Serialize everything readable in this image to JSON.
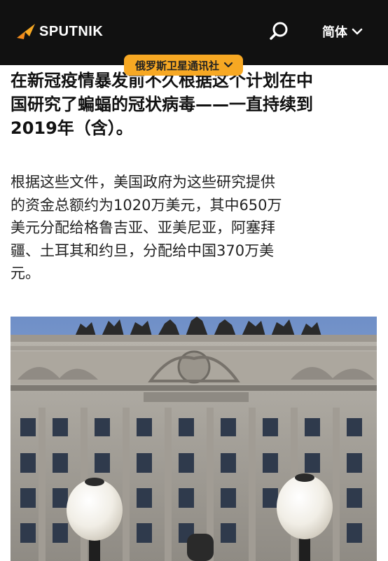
{
  "header": {
    "logo_text": "SPUTNIK",
    "language_label": "简体",
    "search_icon": "search-icon",
    "dropdown_icon": "chevron-down-icon",
    "background": "#111111",
    "accent": "#f7a823"
  },
  "badge": {
    "label": "俄罗斯卫星通讯社",
    "icon": "chevron-down-icon"
  },
  "article": {
    "heading_lines": [
      "在新冠疫情暴发前不久根据这个计划在中",
      "国研究了蝙蝠的冠状病毒——一直持续到",
      "2019年（含）。"
    ],
    "paragraph_lines": [
      "根据这些文件，美国政府为这些研究提供",
      "的资金总额约为1020万美元，其中650万",
      "美元分配给格鲁吉亚、亚美尼亚，阿塞拜",
      "疆、土耳其和约旦，分配给中国370万美",
      "元。"
    ]
  }
}
